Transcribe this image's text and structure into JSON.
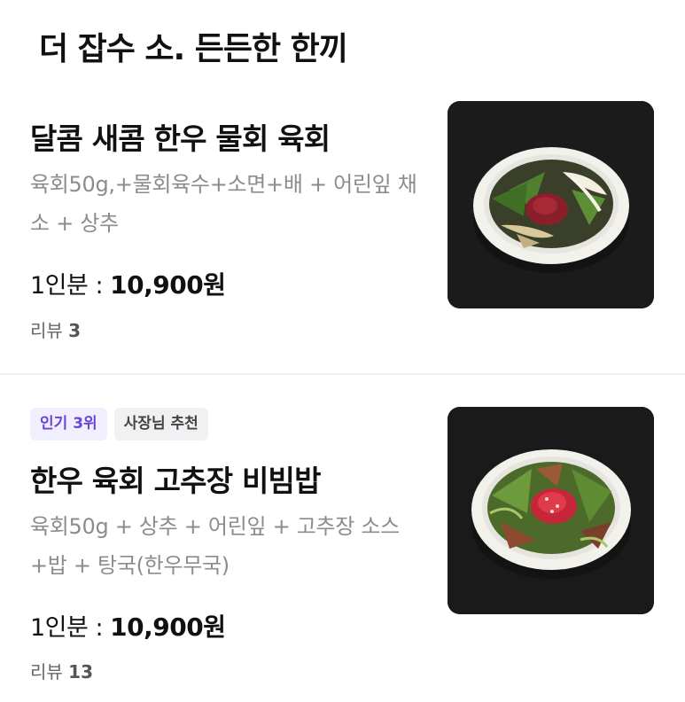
{
  "section": {
    "title": "더 잡수 소. 든든한 한끼"
  },
  "items": [
    {
      "badges": [],
      "name": "달콤 새콤 한우 물회 육회",
      "description": "육회50g,+물회육수+소면+배 + 어린잎 채소 + 상추",
      "price_label": "1인분 :",
      "price": "10,900원",
      "review_label": "리뷰",
      "review_count": "3",
      "image_icon": "food-photo"
    },
    {
      "badges": [
        "인기 3위",
        "사장님 추천"
      ],
      "name": "한우 육회 고추장 비빔밥",
      "description": "육회50g + 상추 + 어린잎 + 고추장 소스+밥 + 탕국(한우무국)",
      "price_label": "1인분 :",
      "price": "10,900원",
      "review_label": "리뷰",
      "review_count": "13",
      "image_icon": "food-photo"
    }
  ],
  "colors": {
    "rank_badge_bg": "#f1eefe",
    "rank_badge_text": "#6a44d9",
    "owner_badge_bg": "#f1f1f3",
    "description_text": "#8c8c8c"
  }
}
